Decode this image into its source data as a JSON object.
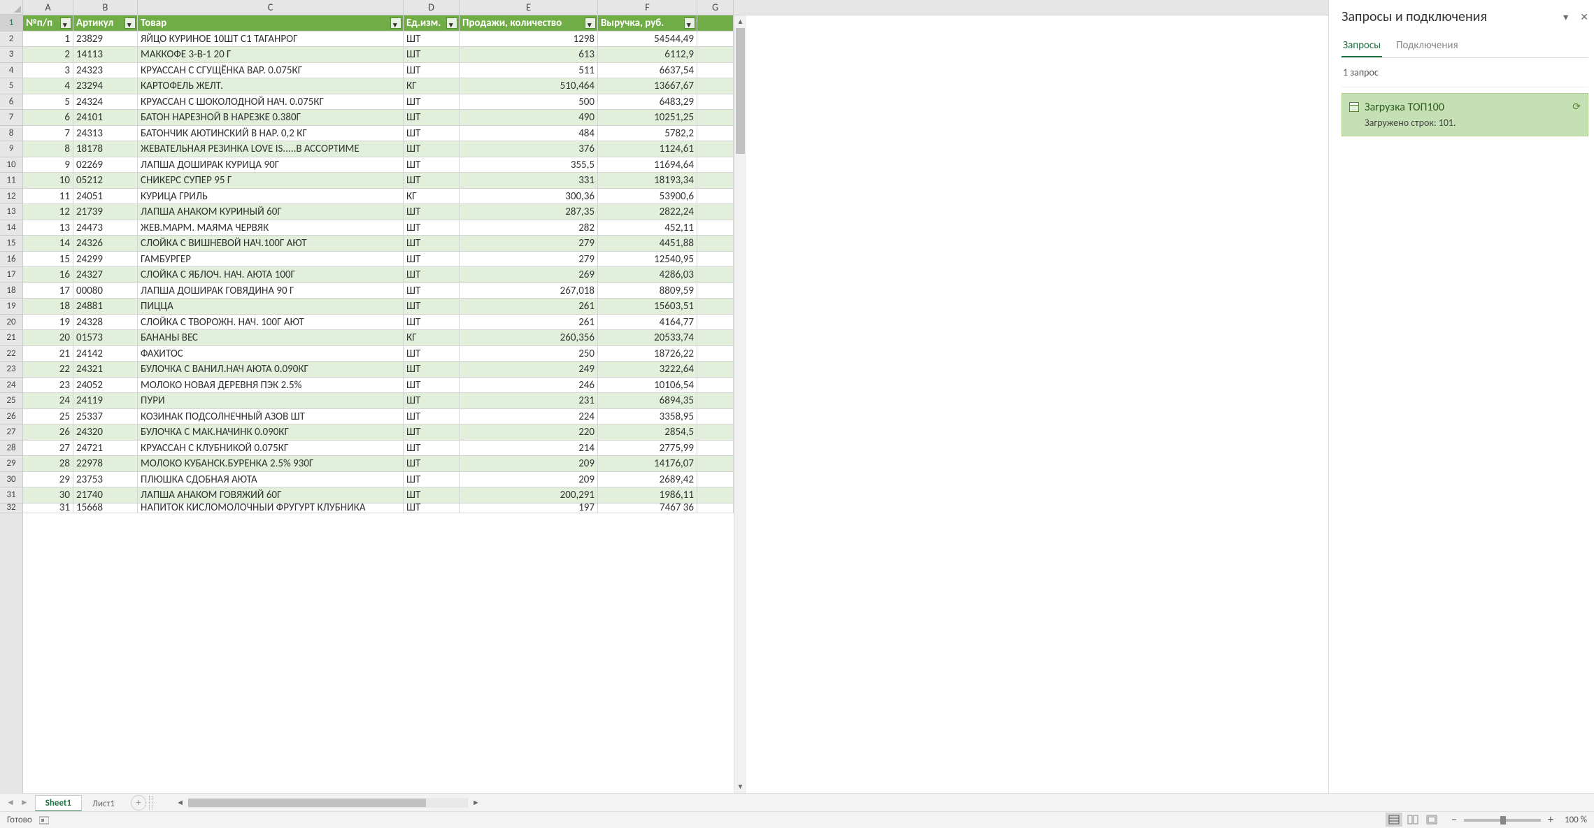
{
  "columns": [
    "A",
    "B",
    "C",
    "D",
    "E",
    "F",
    "G"
  ],
  "headers": {
    "A": "№п/п",
    "B": "Артикул",
    "C": "Товар",
    "D": "Ед.изм.",
    "E": "Продажи, количество",
    "F": "Выручка, руб."
  },
  "rows": [
    {
      "n": 1,
      "art": "23829",
      "name": "ЯЙЦО КУРИНОЕ 10ШТ С1 ТАГАНРОГ",
      "unit": "ШТ",
      "qty": "1298",
      "rev": "54544,49"
    },
    {
      "n": 2,
      "art": "14113",
      "name": "МАККОФЕ 3-В-1 20 Г",
      "unit": "ШТ",
      "qty": "613",
      "rev": "6112,9"
    },
    {
      "n": 3,
      "art": "24323",
      "name": "КРУАССАН С СГУЩЁНКА ВАР.  0.075КГ",
      "unit": "ШТ",
      "qty": "511",
      "rev": "6637,54"
    },
    {
      "n": 4,
      "art": "23294",
      "name": "КАРТОФЕЛЬ ЖЕЛТ.",
      "unit": "КГ",
      "qty": "510,464",
      "rev": "13667,67"
    },
    {
      "n": 5,
      "art": "24324",
      "name": "КРУАССАН С ШОКОЛОДНОЙ НАЧ.  0.075КГ",
      "unit": "ШТ",
      "qty": "500",
      "rev": "6483,29"
    },
    {
      "n": 6,
      "art": "24101",
      "name": "БАТОН НАРЕЗНОЙ В НАРЕЗКЕ 0.380Г",
      "unit": "ШТ",
      "qty": "490",
      "rev": "10251,25"
    },
    {
      "n": 7,
      "art": "24313",
      "name": "БАТОНЧИК АЮТИНСКИЙ В НАР. 0,2 КГ",
      "unit": "ШТ",
      "qty": "484",
      "rev": "5782,2"
    },
    {
      "n": 8,
      "art": "18178",
      "name": "ЖЕВАТЕЛЬНАЯ РЕЗИНКА  LOVE IS.....В АССОРТИМЕ",
      "unit": "ШТ",
      "qty": "376",
      "rev": "1124,61"
    },
    {
      "n": 9,
      "art": "02269",
      "name": "ЛАПША ДОШИРАК КУРИЦА 90Г",
      "unit": "ШТ",
      "qty": "355,5",
      "rev": "11694,64"
    },
    {
      "n": 10,
      "art": "05212",
      "name": "СНИКЕРС СУПЕР 95 Г",
      "unit": "ШТ",
      "qty": "331",
      "rev": "18193,34"
    },
    {
      "n": 11,
      "art": "24051",
      "name": "КУРИЦА ГРИЛЬ",
      "unit": "КГ",
      "qty": "300,36",
      "rev": "53900,6"
    },
    {
      "n": 12,
      "art": "21739",
      "name": "ЛАПША АНАКОМ КУРИНЫЙ  60Г",
      "unit": "ШТ",
      "qty": "287,35",
      "rev": "2822,24"
    },
    {
      "n": 13,
      "art": "24473",
      "name": "ЖЕВ.МАРМ. МАЯМА ЧЕРВЯК",
      "unit": "ШТ",
      "qty": "282",
      "rev": "452,11"
    },
    {
      "n": 14,
      "art": "24326",
      "name": "СЛОЙКА С ВИШНЕВОЙ НАЧ.100Г АЮТ",
      "unit": "ШТ",
      "qty": "279",
      "rev": "4451,88"
    },
    {
      "n": 15,
      "art": "24299",
      "name": "ГАМБУРГЕР",
      "unit": "ШТ",
      "qty": "279",
      "rev": "12540,95"
    },
    {
      "n": 16,
      "art": "24327",
      "name": "СЛОЙКА С ЯБЛОЧ. НАЧ. АЮТА 100Г",
      "unit": "ШТ",
      "qty": "269",
      "rev": "4286,03"
    },
    {
      "n": 17,
      "art": "00080",
      "name": "ЛАПША ДОШИРАК ГОВЯДИНА 90 Г",
      "unit": "ШТ",
      "qty": "267,018",
      "rev": "8809,59"
    },
    {
      "n": 18,
      "art": "24881",
      "name": "ПИЦЦА",
      "unit": "ШТ",
      "qty": "261",
      "rev": "15603,51"
    },
    {
      "n": 19,
      "art": "24328",
      "name": "СЛОЙКА С ТВОРОЖН. НАЧ. 100Г АЮТ",
      "unit": "ШТ",
      "qty": "261",
      "rev": "4164,77"
    },
    {
      "n": 20,
      "art": "01573",
      "name": "БАНАНЫ ВЕС",
      "unit": "КГ",
      "qty": "260,356",
      "rev": "20533,74"
    },
    {
      "n": 21,
      "art": "24142",
      "name": "ФАХИТОС",
      "unit": "ШТ",
      "qty": "250",
      "rev": "18726,22"
    },
    {
      "n": 22,
      "art": "24321",
      "name": "БУЛОЧКА С ВАНИЛ.НАЧ АЮТА 0.090КГ",
      "unit": "ШТ",
      "qty": "249",
      "rev": "3222,64"
    },
    {
      "n": 23,
      "art": "24052",
      "name": "МОЛОКО НОВАЯ ДЕРЕВНЯ ПЭК 2.5%",
      "unit": "ШТ",
      "qty": "246",
      "rev": "10106,54"
    },
    {
      "n": 24,
      "art": "24119",
      "name": "ПУРИ",
      "unit": "ШТ",
      "qty": "231",
      "rev": "6894,35"
    },
    {
      "n": 25,
      "art": "25337",
      "name": "КОЗИНАК ПОДСОЛНЕЧНЫЙ  АЗОВ ШТ",
      "unit": "ШТ",
      "qty": "224",
      "rev": "3358,95"
    },
    {
      "n": 26,
      "art": "24320",
      "name": "БУЛОЧКА С МАК.НАЧИНК 0.090КГ",
      "unit": "ШТ",
      "qty": "220",
      "rev": "2854,5"
    },
    {
      "n": 27,
      "art": "24721",
      "name": "КРУАССАН С КЛУБНИКОЙ 0.075КГ",
      "unit": "ШТ",
      "qty": "214",
      "rev": "2775,99"
    },
    {
      "n": 28,
      "art": "22978",
      "name": "МОЛОКО КУБАНСК.БУРЕНКА 2.5%  930Г",
      "unit": "ШТ",
      "qty": "209",
      "rev": "14176,07"
    },
    {
      "n": 29,
      "art": "23753",
      "name": "ПЛЮШКА СДОБНАЯ АЮТА",
      "unit": "ШТ",
      "qty": "209",
      "rev": "2689,42"
    },
    {
      "n": 30,
      "art": "21740",
      "name": "ЛАПША АНАКОМ ГОВЯЖИЙ  60Г",
      "unit": "ШТ",
      "qty": "200,291",
      "rev": "1986,11"
    }
  ],
  "partial_row": {
    "n": 31,
    "art": "15668",
    "name": "НАПИТОК КИСЛОМОЛОЧНЫЙ ФРУГУРТ КЛУБНИКА",
    "unit": "ШТ",
    "qty": "197",
    "rev": "7467 36"
  },
  "side_panel": {
    "title": "Запросы и подключения",
    "tabs": {
      "queries": "Запросы",
      "connections": "Подключения"
    },
    "count_label": "1 запрос",
    "query": {
      "name": "Загрузка ТОП100",
      "status": "Загружено строк: 101."
    }
  },
  "sheet_bar": {
    "sheets": [
      "Sheet1",
      "Лист1"
    ],
    "active": 0
  },
  "status_bar": {
    "ready": "Готово",
    "zoom": "100 %"
  }
}
